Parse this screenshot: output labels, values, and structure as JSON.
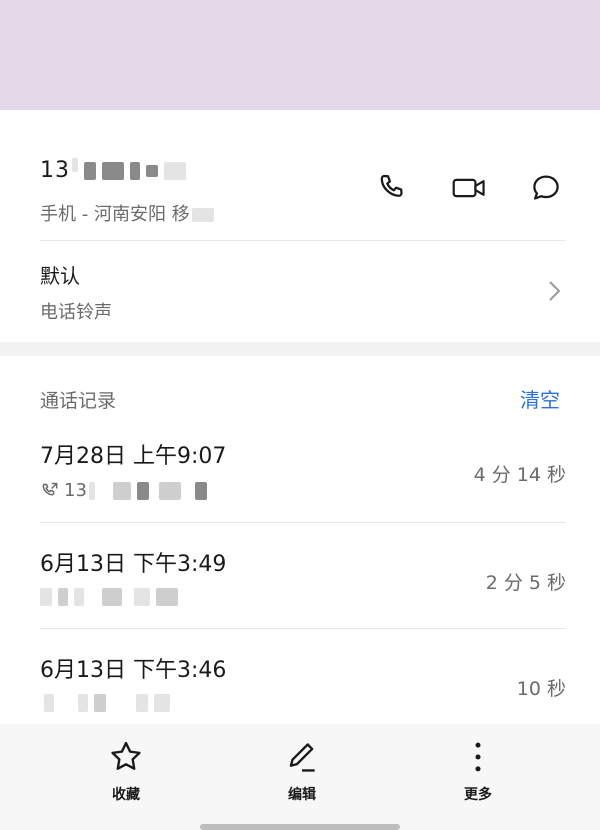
{
  "contact": {
    "number_prefix": "13",
    "number_sub_label": "手机 - 河南安阳 移",
    "actions": [
      "phone-icon",
      "video-call-icon",
      "message-icon"
    ]
  },
  "ringtone": {
    "title": "默认",
    "subtitle": "电话铃声"
  },
  "call_log": {
    "section_title": "通话记录",
    "clear_label": "清空",
    "entries": [
      {
        "time": "7月28日 上午9:07",
        "number_prefix": "13",
        "duration": "4 分 14 秒"
      },
      {
        "time": "6月13日 下午3:49",
        "duration": "2 分 5 秒"
      },
      {
        "time": "6月13日 下午3:46",
        "duration": "10 秒"
      }
    ]
  },
  "bottom_bar": {
    "favorite_label": "收藏",
    "edit_label": "编辑",
    "more_label": "更多"
  },
  "colors": {
    "banner": "#e3d8e8",
    "accent": "#2a6fdb"
  }
}
